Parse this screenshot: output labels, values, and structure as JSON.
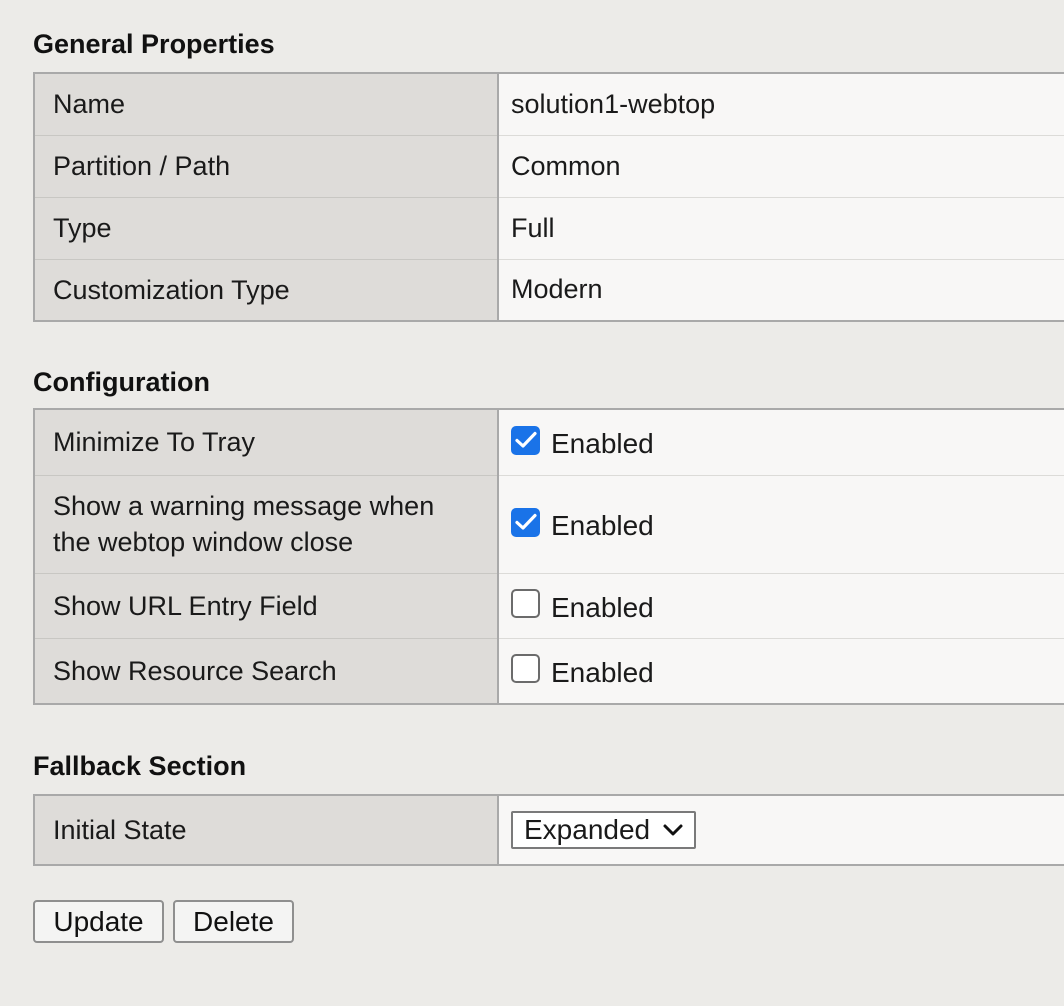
{
  "general": {
    "title": "General Properties",
    "rows": [
      {
        "label": "Name",
        "value": "solution1-webtop"
      },
      {
        "label": "Partition / Path",
        "value": "Common"
      },
      {
        "label": "Type",
        "value": "Full"
      },
      {
        "label": "Customization Type",
        "value": "Modern"
      }
    ]
  },
  "configuration": {
    "title": "Configuration",
    "rows": [
      {
        "label": "Minimize To Tray",
        "checkbox_label": "Enabled",
        "checked": true
      },
      {
        "label_line1": "Show a warning message when",
        "label_line2": "the webtop window close",
        "checkbox_label": "Enabled",
        "checked": true
      },
      {
        "label": "Show URL Entry Field",
        "checkbox_label": "Enabled",
        "checked": false
      },
      {
        "label": "Show Resource Search",
        "checkbox_label": "Enabled",
        "checked": false
      }
    ]
  },
  "fallback": {
    "title": "Fallback Section",
    "rows": [
      {
        "label": "Initial State",
        "selected": "Expanded"
      }
    ]
  },
  "buttons": {
    "update": "Update",
    "delete": "Delete"
  },
  "colors": {
    "checkbox_accent": "#1a73e8",
    "label_cell_bg": "#dedcd9",
    "value_cell_bg": "#f8f7f6",
    "page_bg": "#ecebe8"
  },
  "icons": {
    "checkmark": "check-icon",
    "dropdown": "chevron-down-icon"
  }
}
